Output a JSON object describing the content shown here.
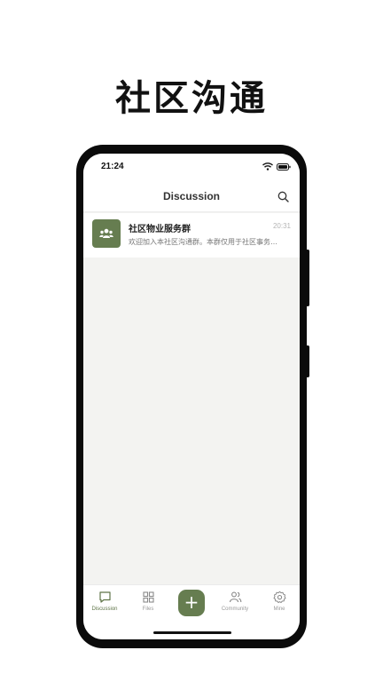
{
  "promo": {
    "title": "社区沟通"
  },
  "status_bar": {
    "time": "21:24"
  },
  "nav": {
    "title": "Discussion",
    "search_icon": "search-icon"
  },
  "chats": [
    {
      "avatar_icon": "group-icon",
      "title": "社区物业服务群",
      "time": "20:31",
      "preview": "欢迎加入本社区沟通群。本群仅用于社区事务…"
    }
  ],
  "tabs": [
    {
      "label": "Discussion",
      "icon": "chat-bubble-icon",
      "active": true
    },
    {
      "label": "Files",
      "icon": "grid-icon",
      "active": false
    },
    {
      "label": "Community",
      "icon": "people-icon",
      "active": false
    },
    {
      "label": "Mine",
      "icon": "gear-icon",
      "active": false
    }
  ],
  "add_button": {
    "label": "+"
  },
  "colors": {
    "accent": "#667d50",
    "active_label": "#5f7548",
    "background": "#f3f3f1"
  }
}
